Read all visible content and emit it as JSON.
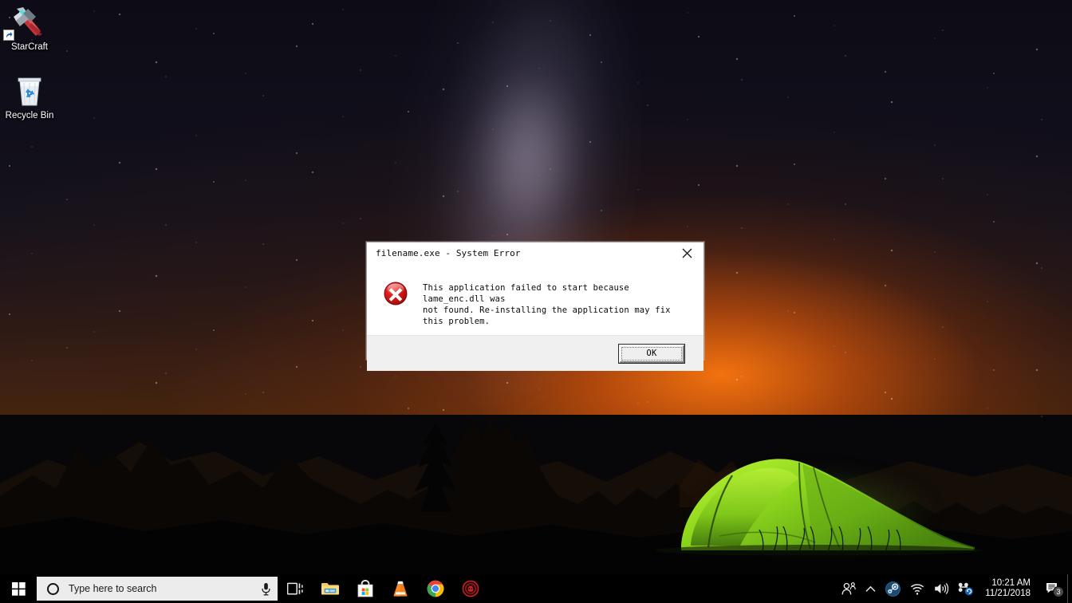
{
  "desktop": {
    "icons": [
      {
        "name": "StarCraft",
        "label": "StarCraft",
        "icon": "starcraft-shortcut-icon",
        "shortcut": true
      },
      {
        "name": "Recycle Bin",
        "label": "Recycle Bin",
        "icon": "recycle-bin-icon",
        "shortcut": false
      }
    ],
    "wallpaper_description": "Night sky with Milky Way over mountain silhouettes, orange sunset glow on horizon and an illuminated green camping tent",
    "colors": {
      "sky_top": "#0d0c16",
      "sunset_glow": "#ff780f",
      "tent_green": "#8fd419",
      "milkyway": "#b0a8c4"
    }
  },
  "dialog": {
    "title": "filename.exe - System Error",
    "close_label": "✕",
    "icon": "error-icon",
    "message": "This application failed to start because lame_enc.dll was\nnot found. Re-installing the application may fix this problem.",
    "buttons": [
      {
        "label": "OK",
        "default": true
      }
    ],
    "colors": {
      "body_bg": "#ffffff",
      "footer_bg": "#f0f0f0",
      "border": "#9b9b9b",
      "error_red": "#cf1313"
    }
  },
  "taskbar": {
    "start": {
      "label": "Start",
      "icon": "windows-logo-icon"
    },
    "search": {
      "placeholder": "Type here to search",
      "cortana_icon": "cortana-circle-icon",
      "mic_icon": "microphone-icon"
    },
    "buttons": [
      {
        "name": "task-view",
        "label": "Task View",
        "icon": "task-view-icon"
      },
      {
        "name": "file-explorer",
        "label": "File Explorer",
        "icon": "file-explorer-icon"
      },
      {
        "name": "microsoft-store",
        "label": "Microsoft Store",
        "icon": "microsoft-store-icon"
      },
      {
        "name": "vlc-media-player",
        "label": "VLC media player",
        "icon": "vlc-cone-icon"
      },
      {
        "name": "google-chrome",
        "label": "Google Chrome",
        "icon": "chrome-icon"
      },
      {
        "name": "red-app",
        "label": "Red App",
        "icon": "red-circle-app-icon"
      }
    ],
    "tray": [
      {
        "name": "people",
        "label": "People",
        "icon": "people-icon"
      },
      {
        "name": "show-hidden-icons",
        "label": "Show hidden icons",
        "icon": "chevron-up-icon"
      },
      {
        "name": "steam",
        "label": "Steam",
        "icon": "steam-icon"
      },
      {
        "name": "network",
        "label": "Network",
        "icon": "wifi-icon"
      },
      {
        "name": "volume",
        "label": "Volume",
        "icon": "speaker-icon"
      },
      {
        "name": "onedrive-sync",
        "label": "Sync",
        "icon": "sync-icon"
      }
    ],
    "clock": {
      "time": "10:21 AM",
      "date": "11/21/2018"
    },
    "action_center": {
      "label": "Action Center",
      "icon": "action-center-icon",
      "badge_count": "3"
    },
    "colors": {
      "bar_bg": "#000000",
      "search_bg": "#ececec",
      "text": "#ffffff"
    }
  }
}
